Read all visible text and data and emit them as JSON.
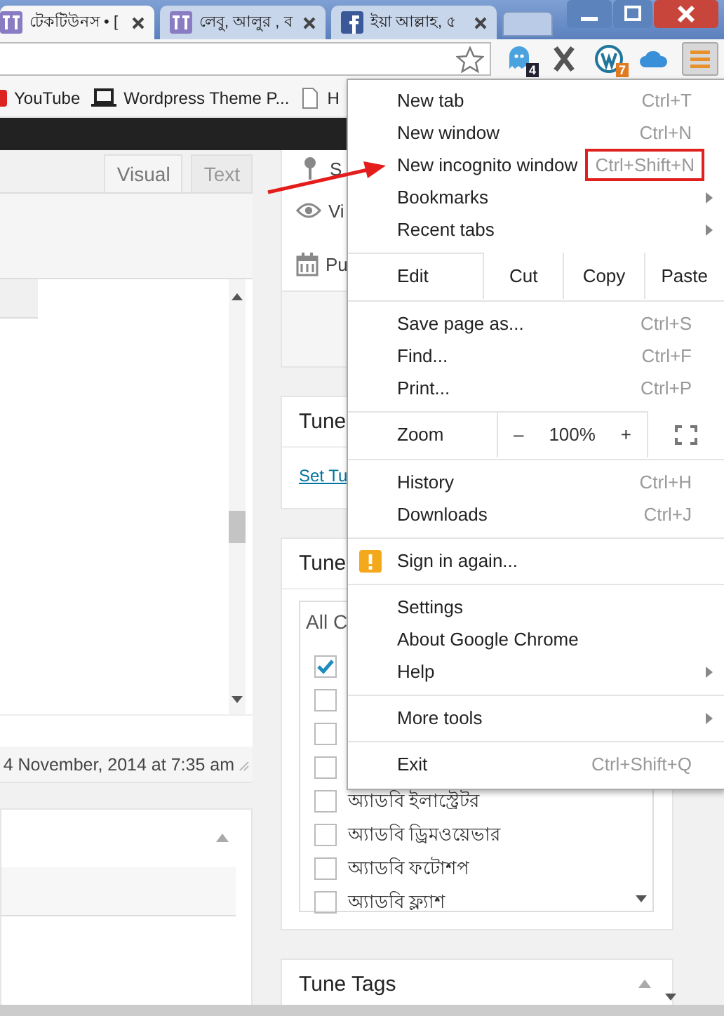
{
  "browser": {
    "tabs": [
      {
        "title": "টেকটিউনস • [",
        "selected": true
      },
      {
        "title": "লেবু, আলুর , ব",
        "selected": false
      },
      {
        "title": "ইয়া আল্লাহ, ৫",
        "selected": false
      }
    ],
    "extension_badges": [
      "4",
      "7"
    ],
    "bookmarks": [
      "YouTube",
      "Wordpress Theme P...",
      "H"
    ]
  },
  "editor": {
    "tabs": [
      {
        "label": "Visual",
        "selected": true
      },
      {
        "label": "Text",
        "selected": false
      }
    ],
    "last_edited": "4 November, 2014 at 7:35 am"
  },
  "sidebar": {
    "publish_rows": [
      "S",
      "Vi",
      "Pu"
    ],
    "boxes": [
      {
        "title": "Tune",
        "link": "Set Tu"
      },
      {
        "title": "Tune",
        "filter": "All C",
        "categories": [
          {
            "checked": true
          },
          {
            "checked": false
          },
          {
            "checked": false
          },
          {
            "checked": false
          },
          {
            "label": "অ্যাডবি ইলাস্ট্রেটর",
            "checked": false
          },
          {
            "label": "অ্যাডবি ড্রিমওয়েভার",
            "checked": false
          },
          {
            "label": "অ্যাডবি ফটোশপ",
            "checked": false
          },
          {
            "label": "অ্যাডবি ফ্ল্যাশ",
            "checked": false
          }
        ]
      },
      {
        "title": "Tune Tags"
      }
    ]
  },
  "menu": {
    "items": [
      {
        "kind": "item",
        "label": "New tab",
        "shortcut": "Ctrl+T",
        "submenu": false,
        "highlighted": false
      },
      {
        "kind": "item",
        "label": "New window",
        "shortcut": "Ctrl+N",
        "submenu": false,
        "highlighted": false
      },
      {
        "kind": "item",
        "label": "New incognito window",
        "shortcut": "Ctrl+Shift+N",
        "submenu": false,
        "highlighted": true
      },
      {
        "kind": "item",
        "label": "Bookmarks",
        "submenu": true,
        "highlighted": false
      },
      {
        "kind": "item",
        "label": "Recent tabs",
        "submenu": true,
        "highlighted": false
      },
      {
        "kind": "separator"
      },
      {
        "kind": "edit",
        "label": "Edit",
        "buttons": [
          "Cut",
          "Copy",
          "Paste"
        ]
      },
      {
        "kind": "separator"
      },
      {
        "kind": "item",
        "label": "Save page as...",
        "shortcut": "Ctrl+S",
        "submenu": false,
        "highlighted": false
      },
      {
        "kind": "item",
        "label": "Find...",
        "shortcut": "Ctrl+F",
        "submenu": false,
        "highlighted": false
      },
      {
        "kind": "item",
        "label": "Print...",
        "shortcut": "Ctrl+P",
        "submenu": false,
        "highlighted": false
      },
      {
        "kind": "separator"
      },
      {
        "kind": "zoom",
        "label": "Zoom",
        "minus": "–",
        "value": "100%",
        "plus": "+"
      },
      {
        "kind": "separator"
      },
      {
        "kind": "item",
        "label": "History",
        "shortcut": "Ctrl+H",
        "submenu": false,
        "highlighted": false
      },
      {
        "kind": "item",
        "label": "Downloads",
        "shortcut": "Ctrl+J",
        "submenu": false,
        "highlighted": false
      },
      {
        "kind": "separator"
      },
      {
        "kind": "warning",
        "label": "Sign in again..."
      },
      {
        "kind": "separator"
      },
      {
        "kind": "item",
        "label": "Settings",
        "submenu": false,
        "highlighted": false
      },
      {
        "kind": "item",
        "label": "About Google Chrome",
        "submenu": false,
        "highlighted": false
      },
      {
        "kind": "item",
        "label": "Help",
        "submenu": true,
        "highlighted": false
      },
      {
        "kind": "separator"
      },
      {
        "kind": "item",
        "label": "More tools",
        "submenu": true,
        "highlighted": false
      },
      {
        "kind": "separator"
      },
      {
        "kind": "item",
        "label": "Exit",
        "shortcut": "Ctrl+Shift+Q",
        "submenu": false,
        "highlighted": false
      }
    ]
  },
  "annotations": [
    {
      "kind": "arrow"
    }
  ]
}
